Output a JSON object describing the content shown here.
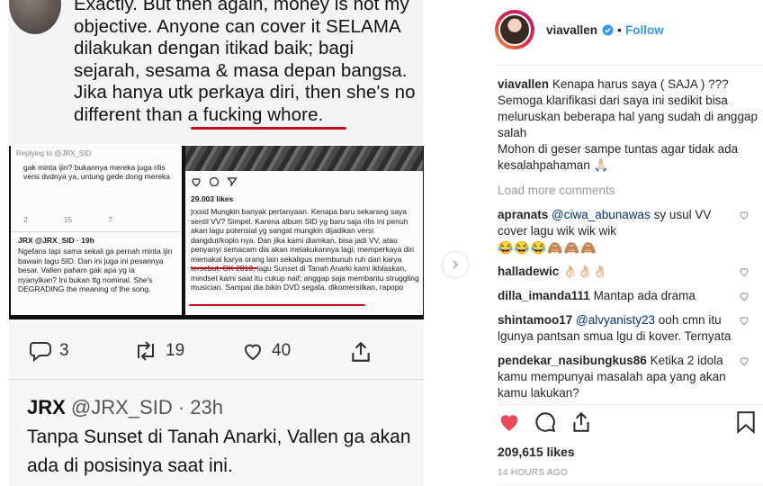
{
  "post_image": {
    "top_text": "Exactly. But then again, money is not my objective. Anyone can cover it SELAMA dilakukan dengan itikad baik; bagi sejarah, sesama & masa depan bangsa. Jika hanya utk perkaya diri, then she's no different than a fucking whore.",
    "mid_left": {
      "replying": "Replying to @JRX_SID",
      "reply_text": "gak minta ijin? bukannya mereka juga rilis versi dvdnya ya, untung gede dong mereka",
      "reply_counts": [
        "2",
        "15",
        "7"
      ],
      "tweet_head": "JRX @JRX_SID · 19h",
      "tweet_text": "Ngefans tapi sama sekali ga pernah minta ijin bawain lagu SID. Dan ini juga ini pesannya besar. Vallen paham gak apa yg ia nyanyikan? Ini bukan ttg nominal. She's DEGRADING the meaning of the song."
    },
    "mid_right": {
      "likes": "29.003 likes",
      "caption": "jrxsid Mungkin banyak pertanyaan. Kenapa baru sekarang saya sentil VV? Simpel. Karena album SID yg baru saja rilis ini penuh akan lagu potensial yg sangat mungkin dijadikan versi dangdut/koplo nya. Dan jika kami diamkan, bisa jadi VV, atau penyanyi semacam dia akan melakukannya lagi; memperkaya diri memakai karya orang lain sekaligus membunuh ruh dari karya tersebut. OK 2013, lagu Sunset di Tanah Anarki kami ikhlaskan, mindset kami saat itu cukup naif; anggap saja membantu struggling musician. Sampai dia bikin DVD segala, dikomersilkan, rapopo"
    },
    "tweet_actions": {
      "replies": "3",
      "retweets": "19",
      "likes": "40"
    },
    "tweet_name": "JRX",
    "tweet_handle": "@JRX_SID · 23h",
    "tweet_text": "Tanpa Sunset di Tanah Anarki, Vallen ga akan ada di posisinya saat ini."
  },
  "header": {
    "username": "viavallen",
    "dot": "•",
    "follow_label": "Follow"
  },
  "caption": {
    "username": "viavallen",
    "text_1": "Kenapa harus saya ( SAJA ) ??? Semoga klarifikasi dari saya ini sedikit bisa meluruskan beberapa hal yang sudah di anggap salah",
    "text_2": "Mohon di geser sampe tuntas agar tidak ada kesalahpahaman 🙏🏻"
  },
  "load_more": "Load more comments",
  "comments": [
    {
      "username": "apranats",
      "mention": "@ciwa_abunawas",
      "text": " sy usul VV cover lagu wik wik wik",
      "emoji": "😂😂😂🙈🙈🙈"
    },
    {
      "username": "halladewic",
      "mention": "",
      "text": " 👌🏻👌🏻👌🏻",
      "emoji": ""
    },
    {
      "username": "dilla_imanda111",
      "mention": "",
      "text": " Mantap ada drama",
      "emoji": ""
    },
    {
      "username": "shintamoo17",
      "mention": "@alvyanisty23",
      "text": " ooh cmn itu lgunya pantsan smua lgu di kover. Ternyata",
      "emoji": ""
    },
    {
      "username": "pendekar_nasibungkus86",
      "mention": "",
      "text": " Ketika 2 idola kamu mempunyai masalah apa yang akan kamu lakukan?",
      "emoji": ""
    }
  ],
  "likes": "209,615 likes",
  "time_ago": "14 HOURS AGO",
  "colors": {
    "accent": "#3897f0",
    "heart": "#ed4956",
    "verified": "#3897f0",
    "underline": "#c40d1f"
  },
  "icons": [
    "verified-badge-icon",
    "heart-icon",
    "comment-icon",
    "share-icon",
    "bookmark-icon",
    "chevron-right-icon",
    "reply-icon",
    "retweet-icon"
  ]
}
